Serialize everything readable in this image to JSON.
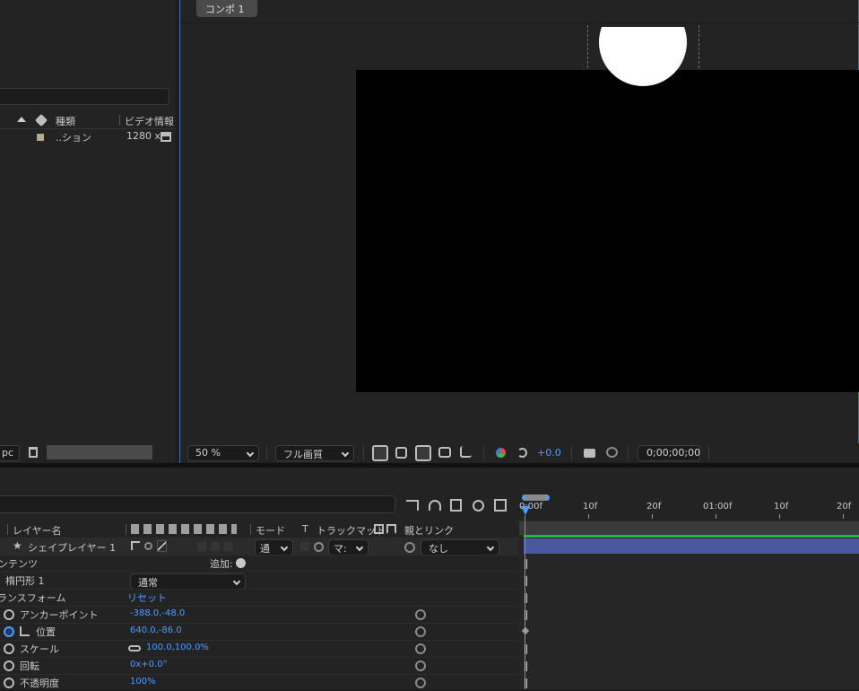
{
  "project": {
    "col_type": "種類",
    "col_video": "ビデオ情報",
    "item_type": "..ション",
    "item_video": "1280 x",
    "bpc": "pc"
  },
  "viewer": {
    "tab": "コンポ 1",
    "zoom": "50 %",
    "quality": "フル画質",
    "exposure": "+0.0",
    "timecode": "0;00;00;00"
  },
  "timeline": {
    "col_layer_name": "レイヤー名",
    "col_mode": "モード",
    "col_t": "T",
    "col_trackmatte": "トラックマット",
    "col_parent": "親とリンク",
    "layer_name": "シェイプレイヤー 1",
    "layer_mode": "通",
    "layer_matte": "マ:",
    "layer_parent": "なし",
    "contents": "ンテンツ",
    "add_label": "追加:",
    "ellipse": "楕円形 1",
    "ellipse_mode": "通常",
    "transform": "ランスフォーム",
    "reset": "リセット",
    "props": [
      {
        "name": "アンカーポイント",
        "value": "-388.0,-48.0"
      },
      {
        "name": "位置",
        "value": "640.0,-86.0"
      },
      {
        "name": "スケール",
        "value": "100.0,100.0%"
      },
      {
        "name": "回転",
        "value": "0x+0.0°"
      },
      {
        "name": "不透明度",
        "value": "100%"
      }
    ],
    "ruler": [
      "0:00f",
      "10f",
      "20f",
      "01:00f",
      "10f",
      "20f"
    ]
  }
}
